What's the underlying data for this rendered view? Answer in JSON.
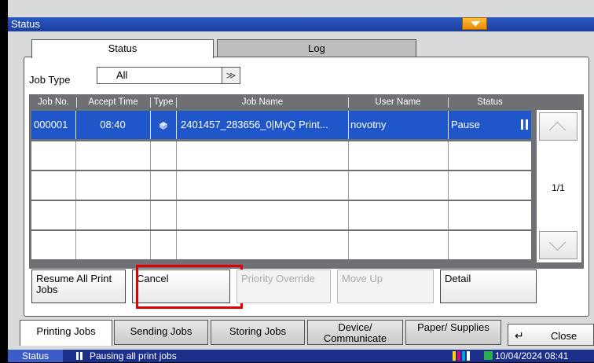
{
  "window": {
    "title": "Status"
  },
  "tabs": {
    "status": "Status",
    "log": "Log"
  },
  "job_type": {
    "label": "Job Type",
    "value": "All"
  },
  "table": {
    "headers": [
      "Job No.",
      "Accept Time",
      "Type",
      "Job Name",
      "User Name",
      "Status"
    ],
    "rows": [
      {
        "job_no": "000001",
        "accept_time": "08:40",
        "job_name": "2401457_283656_0|MyQ Print...",
        "user_name": "novotny",
        "status": "Pause"
      }
    ]
  },
  "pager": {
    "page": "1/1"
  },
  "actions": {
    "resume_all": "Resume All Print Jobs",
    "cancel": "Cancel",
    "priority_override": "Priority Override",
    "move_up": "Move Up",
    "detail": "Detail"
  },
  "bottom_tabs": {
    "printing": "Printing Jobs",
    "sending": "Sending Jobs",
    "storing": "Storing Jobs",
    "device": "Device/ Communicate",
    "paper": "Paper/ Supplies",
    "close": "Close"
  },
  "statusbar": {
    "label": "Status",
    "message": "Pausing all print jobs",
    "datetime": "10/04/2024  08:41"
  },
  "colors": {
    "title_bar": "#1c3f9c",
    "selected_row": "#1f56c9",
    "highlight": "#e10000",
    "expand_button": "#f5a100"
  },
  "icons": {
    "expand": "chevron-down-icon",
    "pause": "pause-icon",
    "scroll_up": "chevron-up-icon",
    "scroll_down": "chevron-down-icon",
    "close": "return-arrow-icon",
    "job_type": "document-icon"
  }
}
